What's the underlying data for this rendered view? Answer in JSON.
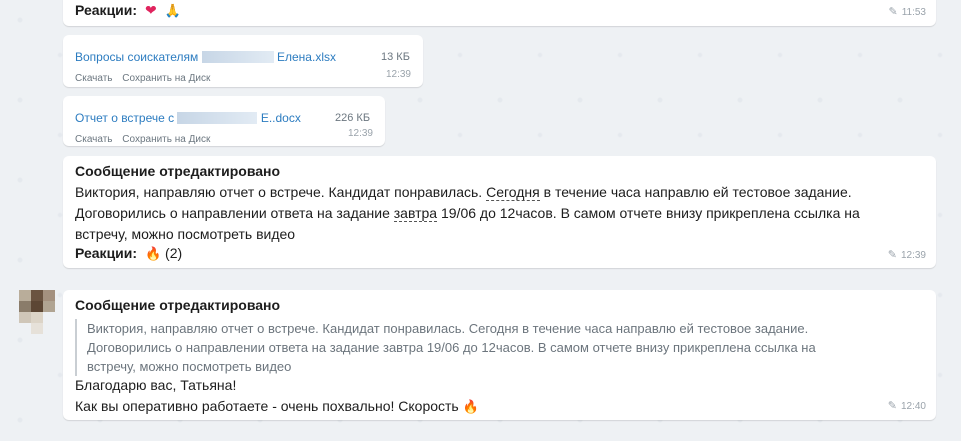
{
  "colors": {
    "background": "#eef1f4",
    "bubble": "#ffffff",
    "link": "#2c7cc0",
    "muted": "#9aa3ab"
  },
  "msg1": {
    "reactions_label": "Реакции:",
    "reaction_icons": [
      "red-heart-icon",
      "folded-hands-icon"
    ],
    "reaction_glyphs": [
      "❤",
      "🙏"
    ],
    "edited_icon": "pencil-icon",
    "time": "11:53"
  },
  "file1": {
    "name_prefix": "Вопросы соискателям",
    "name_suffix": "Елена.xlsx",
    "size": "13 КБ",
    "download": "Скачать",
    "save_to_disk": "Сохранить на Диск",
    "time": "12:39"
  },
  "file2": {
    "name_prefix": "Отчет о встрече с",
    "name_suffix": "Е..docx",
    "size": "226 КБ",
    "download": "Скачать",
    "save_to_disk": "Сохранить на Диск",
    "time": "12:39"
  },
  "msg4": {
    "title": "Сообщение отредактировано",
    "line1_a": "Виктория, направляю отчет о встрече. Кандидат понравилась. ",
    "line1_link": "Сегодня",
    "line1_b": " в течение часа направлю ей тестовое задание.",
    "line2_a": "Договорились о направлении ответа на задание ",
    "line2_link": "завтра",
    "line2_b": " 19/06 до 12часов. В самом отчете внизу прикреплена ссылка на",
    "line3": "встречу, можно посмотреть видео",
    "reactions_label": "Реакции:",
    "reaction_glyph": "🔥",
    "reaction_count": "(2)",
    "time": "12:39"
  },
  "msg5": {
    "title": "Сообщение отредактировано",
    "quote": [
      "Виктория, направляю отчет о встрече. Кандидат понравилась. Сегодня в течение часа направлю ей тестовое задание.",
      "Договорились о направлении ответа на задание завтра 19/06 до 12часов. В самом отчете внизу прикреплена ссылка на",
      "встречу, можно посмотреть видео"
    ],
    "reply_line1": "Благодарю вас, Татьяна!",
    "reply_line2": "Как вы оперативно работаете - очень похвально! Скорость",
    "reply_glyph": "🔥",
    "time": "12:40"
  }
}
